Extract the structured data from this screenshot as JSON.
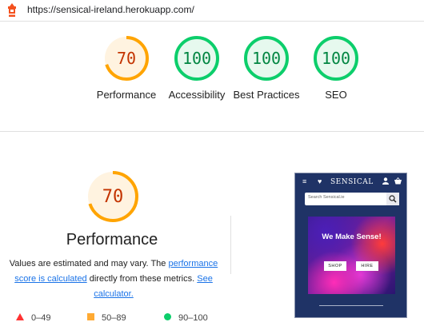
{
  "url_bar": {
    "url": "https://sensical-ireland.herokuapp.com/",
    "icon": "lighthouse-icon"
  },
  "summary": [
    {
      "key": "performance",
      "score": "70",
      "label": "Performance",
      "status": "average",
      "color": "#c33300"
    },
    {
      "key": "accessibility",
      "score": "100",
      "label": "Accessibility",
      "status": "pass",
      "color": "#018642"
    },
    {
      "key": "best_practices",
      "score": "100",
      "label": "Best Practices",
      "status": "pass",
      "color": "#018642"
    },
    {
      "key": "seo",
      "score": "100",
      "label": "SEO",
      "status": "pass",
      "color": "#018642"
    }
  ],
  "performance_section": {
    "score": "70",
    "title": "Performance",
    "desc_part1": "Values are estimated and may vary. The ",
    "link1": "performance score is calculated",
    "desc_part2": " directly from these metrics. ",
    "link2": "See calculator."
  },
  "legend": [
    {
      "label": "0–49",
      "color": "#ff3333",
      "shape": "triangle"
    },
    {
      "label": "50–89",
      "color": "#ffaa33",
      "shape": "square"
    },
    {
      "label": "90–100",
      "color": "#0cce6b",
      "shape": "circle"
    }
  ],
  "screenshot": {
    "brand": "SENSICAL",
    "search_placeholder": "Search Sensical.ie",
    "hero_title": "We Make Sense!",
    "shop_label": "SHOP",
    "hire_label": "HIRE",
    "icons": [
      "menu-icon",
      "heart-icon",
      "user-icon",
      "basket-icon",
      "search-icon"
    ]
  },
  "colors": {
    "pass": "#0cce6b",
    "average": "#ffa400",
    "link": "#1a73e8"
  }
}
